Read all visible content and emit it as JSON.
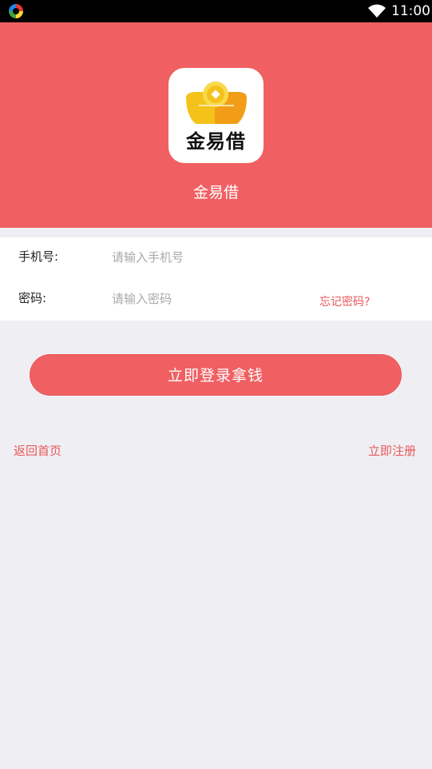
{
  "status_bar": {
    "time": "11:00",
    "app_icon": "colorful-circle-icon",
    "wifi_icon": "wifi-icon"
  },
  "header": {
    "logo_text": "金易借",
    "app_name": "金易借",
    "background": "#f06063"
  },
  "form": {
    "phone": {
      "label": "手机号:",
      "placeholder": "请输入手机号",
      "value": ""
    },
    "password": {
      "label": "密码:",
      "placeholder": "请输入密码",
      "value": ""
    },
    "forgot_label": "忘记密码?"
  },
  "actions": {
    "login_label": "立即登录拿钱",
    "home_label": "返回首页",
    "register_label": "立即注册"
  },
  "colors": {
    "accent": "#f06063",
    "link": "#e9585b",
    "page_background": "#efeff3"
  }
}
